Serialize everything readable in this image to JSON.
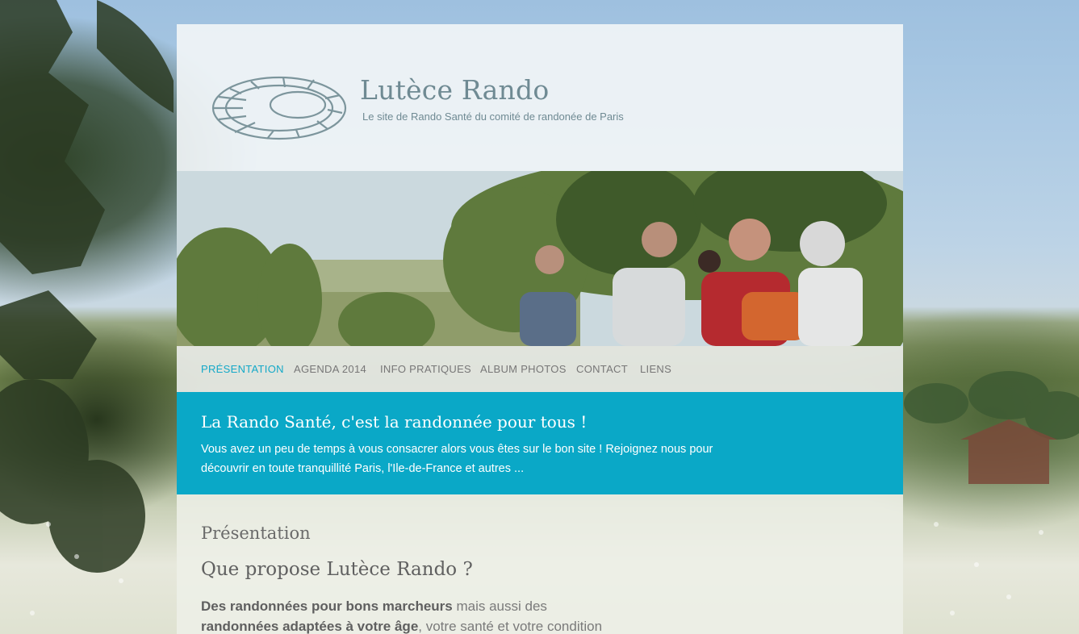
{
  "site": {
    "title": "Lutèce Rando",
    "tagline": "Le site de Rando Santé du comité de randonée de Paris",
    "logo_icon": "arena-logo-icon"
  },
  "nav": {
    "items": [
      {
        "label": "PRÉSENTATION",
        "active": true
      },
      {
        "label": "AGENDA 2014",
        "active": false
      },
      {
        "label": "INFO PRATIQUES",
        "active": false
      },
      {
        "label": "ALBUM PHOTOS",
        "active": false
      },
      {
        "label": "CONTACT",
        "active": false
      },
      {
        "label": "LIENS",
        "active": false
      }
    ]
  },
  "banner": {
    "title": "La Rando Santé, c'est la randonnée pour tous !",
    "text": "Vous avez un peu de temps à vous consacrer alors vous êtes sur le bon site ! Rejoignez nous pour découvrir en toute tranquillité Paris, l'Ile-de-France et autres ..."
  },
  "content": {
    "heading": "Présentation",
    "subheading": "Que propose Lutèce Rando ?",
    "bold1": "Des randonnées pour bons marcheurs",
    "text1": " mais aussi des",
    "bold2": "randonnées adaptées à votre âge",
    "text2": ", votre santé et votre condition"
  },
  "colors": {
    "accent": "#0aa8c7",
    "active_nav": "#14a9c8",
    "title_gray": "#6f8a93"
  }
}
